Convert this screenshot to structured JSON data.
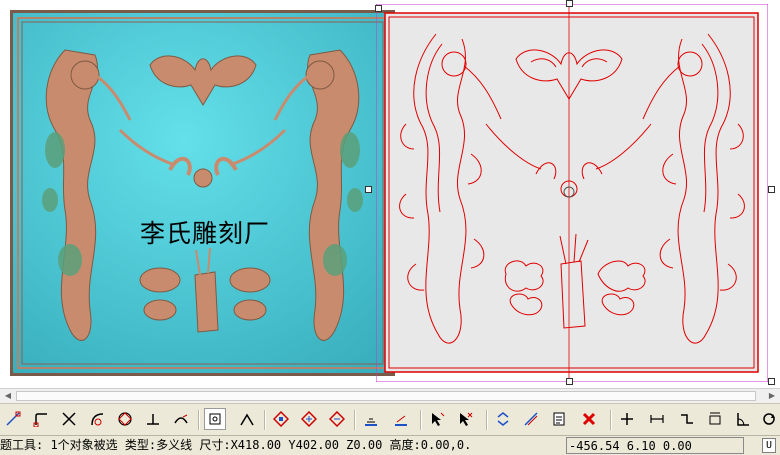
{
  "watermark": "李氏雕刻厂",
  "status": {
    "main": "题工具: 1个对象被选 类型:多义线 尺寸:X418.00 Y402.00 Z0.00 高度:0.00,0.",
    "coords": "-456.54 6.10 0.00",
    "unit": "U"
  },
  "colors": {
    "relief_bg": "#4fc7d4",
    "relief_frame": "#b7826a",
    "dragon": "#c98b6e",
    "vector_line": "#e00000",
    "vector_bg": "#e8e8e8",
    "selection": "#cc33cc"
  },
  "toolbar": {
    "tools": [
      {
        "name": "snap-endpoint-icon"
      },
      {
        "name": "snap-corner-icon"
      },
      {
        "name": "snap-intersection-icon"
      },
      {
        "name": "snap-tangent-icon"
      },
      {
        "name": "snap-quadrant-icon"
      },
      {
        "name": "snap-perpendicular-icon"
      },
      {
        "name": "snap-nearest-icon"
      },
      {
        "name": "snap-center-icon",
        "active": true
      },
      {
        "name": "snap-angle-icon"
      },
      {
        "name": "node-edit-icon"
      },
      {
        "name": "node-add-icon"
      },
      {
        "name": "node-delete-icon"
      },
      {
        "name": "align-horizontal-icon"
      },
      {
        "name": "align-vertical-icon"
      },
      {
        "name": "select-pointer-icon"
      },
      {
        "name": "select-remove-icon"
      },
      {
        "name": "arrange-icon"
      },
      {
        "name": "measure-icon"
      },
      {
        "name": "list-icon"
      },
      {
        "name": "delete-icon"
      },
      {
        "name": "crosshair-icon"
      },
      {
        "name": "dimension-icon"
      },
      {
        "name": "step-icon"
      },
      {
        "name": "box-dimension-icon"
      },
      {
        "name": "angle-dimension-icon"
      },
      {
        "name": "rotate-view-icon"
      }
    ]
  }
}
